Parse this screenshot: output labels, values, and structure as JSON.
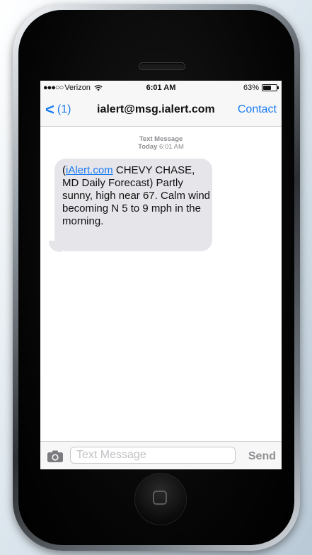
{
  "status_bar": {
    "signal_dots": "●●●○○",
    "carrier": "Verizon",
    "wifi_icon": "wifi-icon",
    "time": "6:01 AM",
    "battery_percent_label": "63%",
    "battery_level": 0.63
  },
  "nav_bar": {
    "back_chevron": "<",
    "back_count": "(1)",
    "title": "ialert@msg.ialert.com",
    "contact_label": "Contact"
  },
  "conversation": {
    "meta_title": "Text Message",
    "meta_day": "Today",
    "meta_time": "6:01 AM",
    "message": {
      "open_paren": "(",
      "link_text": "iAlert.com",
      "body": " CHEVY CHASE, MD Daily Forecast) Partly sunny, high near 67. Calm wind becoming N 5 to 9 mph in the morning."
    }
  },
  "input_bar": {
    "camera_icon": "camera-icon",
    "placeholder": "Text Message",
    "value": "",
    "send_label": "Send"
  },
  "device": {
    "home_icon": "home-square-icon"
  },
  "colors": {
    "ios_blue": "#1a7cf2",
    "bubble_gray": "#e5e5ea",
    "meta_gray": "#8e8e93"
  }
}
